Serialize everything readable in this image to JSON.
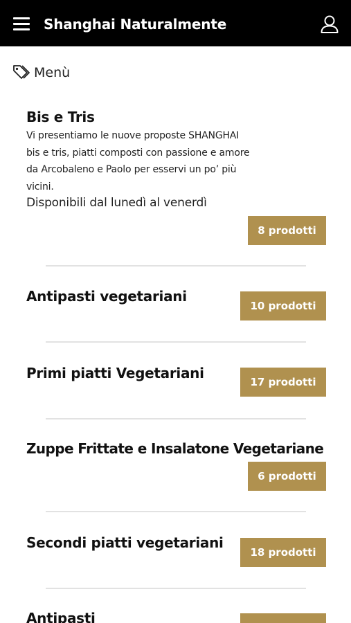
{
  "app_bar": {
    "title": "Shanghai Naturalmente",
    "menu_icon": "hamburger-menu-icon",
    "user_icon": "user-account-icon",
    "background": "#000000"
  },
  "section": {
    "label": "Menù",
    "icon": "tag-icon"
  },
  "accent_color": "#b0914f",
  "categories": [
    {
      "title": "Bis e Tris",
      "description_lines": [
        "Vi presentiamo le nuove proposte SHANGHAI",
        "bis e tris, piatti composti con passione e amore",
        "da Arcobaleno e Paolo per esservi un po’ più",
        "vicini."
      ],
      "availability": "Disponibili dal lunedì al venerdì",
      "count_label": "8 prodotti"
    },
    {
      "title": "Antipasti vegetariani",
      "count_label": "10 prodotti"
    },
    {
      "title": "Primi piatti Vegetariani",
      "count_label": "17 prodotti"
    },
    {
      "title": "Zuppe Frittate e Insalatone Vegetariane",
      "count_label": "6 prodotti"
    },
    {
      "title": "Secondi piatti vegetariani",
      "count_label": "18 prodotti"
    },
    {
      "title": "Antipasti",
      "count_label": ""
    }
  ]
}
